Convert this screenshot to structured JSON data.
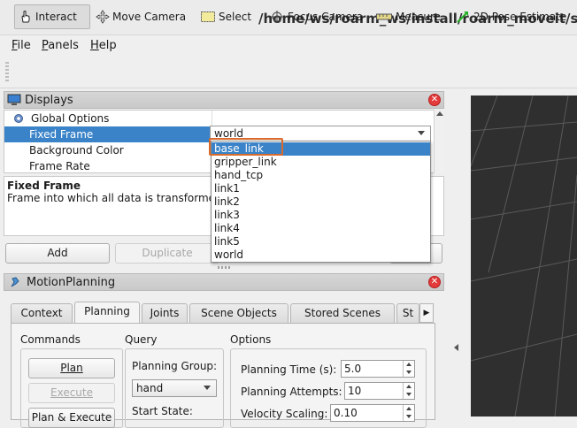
{
  "window": {
    "title": "/home/ws/roarm_ws/install/roarm_moveit/share/r"
  },
  "menu": {
    "file": "File",
    "file_key": "F",
    "file_rest": "ile",
    "panels_key": "P",
    "panels_rest": "anels",
    "help_key": "H",
    "help_rest": "elp"
  },
  "toolbar": {
    "interact": "Interact",
    "move_camera": "Move Camera",
    "select": "Select",
    "focus_camera": "Focus Camera",
    "measure": "Measure",
    "pose_estimate": "2D Pose Estimate"
  },
  "displays": {
    "title": "Displays",
    "close": "✕",
    "rows": {
      "global_options": "Global Options",
      "fixed_frame": "Fixed Frame",
      "background_color": "Background Color",
      "frame_rate": "Frame Rate"
    },
    "fixed_frame_value": "world",
    "description_title": "Fixed Frame",
    "description_body": "Frame into which all data is transforme",
    "buttons": {
      "add": "Add",
      "duplicate": "Duplicate"
    }
  },
  "frame_dropdown": {
    "options": [
      "base_link",
      "gripper_link",
      "hand_tcp",
      "link1",
      "link2",
      "link3",
      "link4",
      "link5",
      "world"
    ],
    "highlighted": "base_link"
  },
  "motion_planning": {
    "title": "MotionPlanning",
    "close": "✕",
    "tabs": [
      "Context",
      "Planning",
      "Joints",
      "Scene Objects",
      "Stored Scenes",
      "St"
    ],
    "active_tab": "Planning",
    "commands": {
      "label": "Commands",
      "plan": "Plan",
      "execute": "Execute",
      "plan_execute": "Plan & Execute"
    },
    "query": {
      "label": "Query",
      "planning_group_label": "Planning Group:",
      "planning_group_value": "hand",
      "start_state_label": "Start State:"
    },
    "options": {
      "label": "Options",
      "planning_time_label": "Planning Time (s):",
      "planning_time_value": "5.0",
      "planning_attempts_label": "Planning Attempts:",
      "planning_attempts_value": "10",
      "velocity_scaling_label": "Velocity Scaling:",
      "velocity_scaling_value": "0.10"
    }
  },
  "colors": {
    "selection": "#3a83c8",
    "highlight_box": "#d96a2c",
    "close_red": "#e33a3a",
    "viewport_bg": "#2f2f2f"
  }
}
